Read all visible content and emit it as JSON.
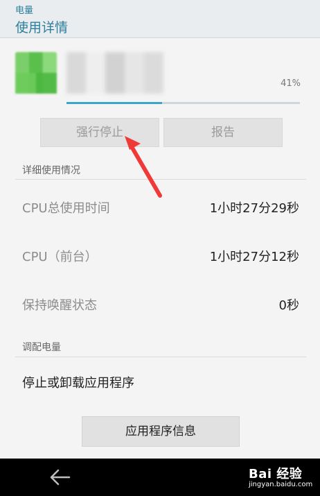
{
  "header": {
    "subtitle": "电量",
    "title": "使用详情"
  },
  "app": {
    "percent_label": "41%",
    "battery_fraction": 0.41
  },
  "buttons": {
    "force_stop": "强行停止",
    "report": "报告"
  },
  "details": {
    "heading": "详细使用情况",
    "rows": [
      {
        "label": "CPU总使用时间",
        "value": "1小时27分29秒"
      },
      {
        "label": "CPU（前台）",
        "value": "1小时27分12秒"
      },
      {
        "label": "保持唤醒状态",
        "value": "0秒"
      }
    ]
  },
  "power": {
    "heading": "调配电量",
    "action": "停止或卸载应用程序",
    "app_info_button": "应用程序信息"
  },
  "navbar": {
    "back_icon": "back-arrow-icon",
    "watermark_brand": "Bai 经验",
    "watermark_url": "jingyan.baidu.com"
  },
  "colors": {
    "accent": "#2d7f9b",
    "progress": "#3aa6c7",
    "annotation_arrow": "#f03a3a"
  }
}
